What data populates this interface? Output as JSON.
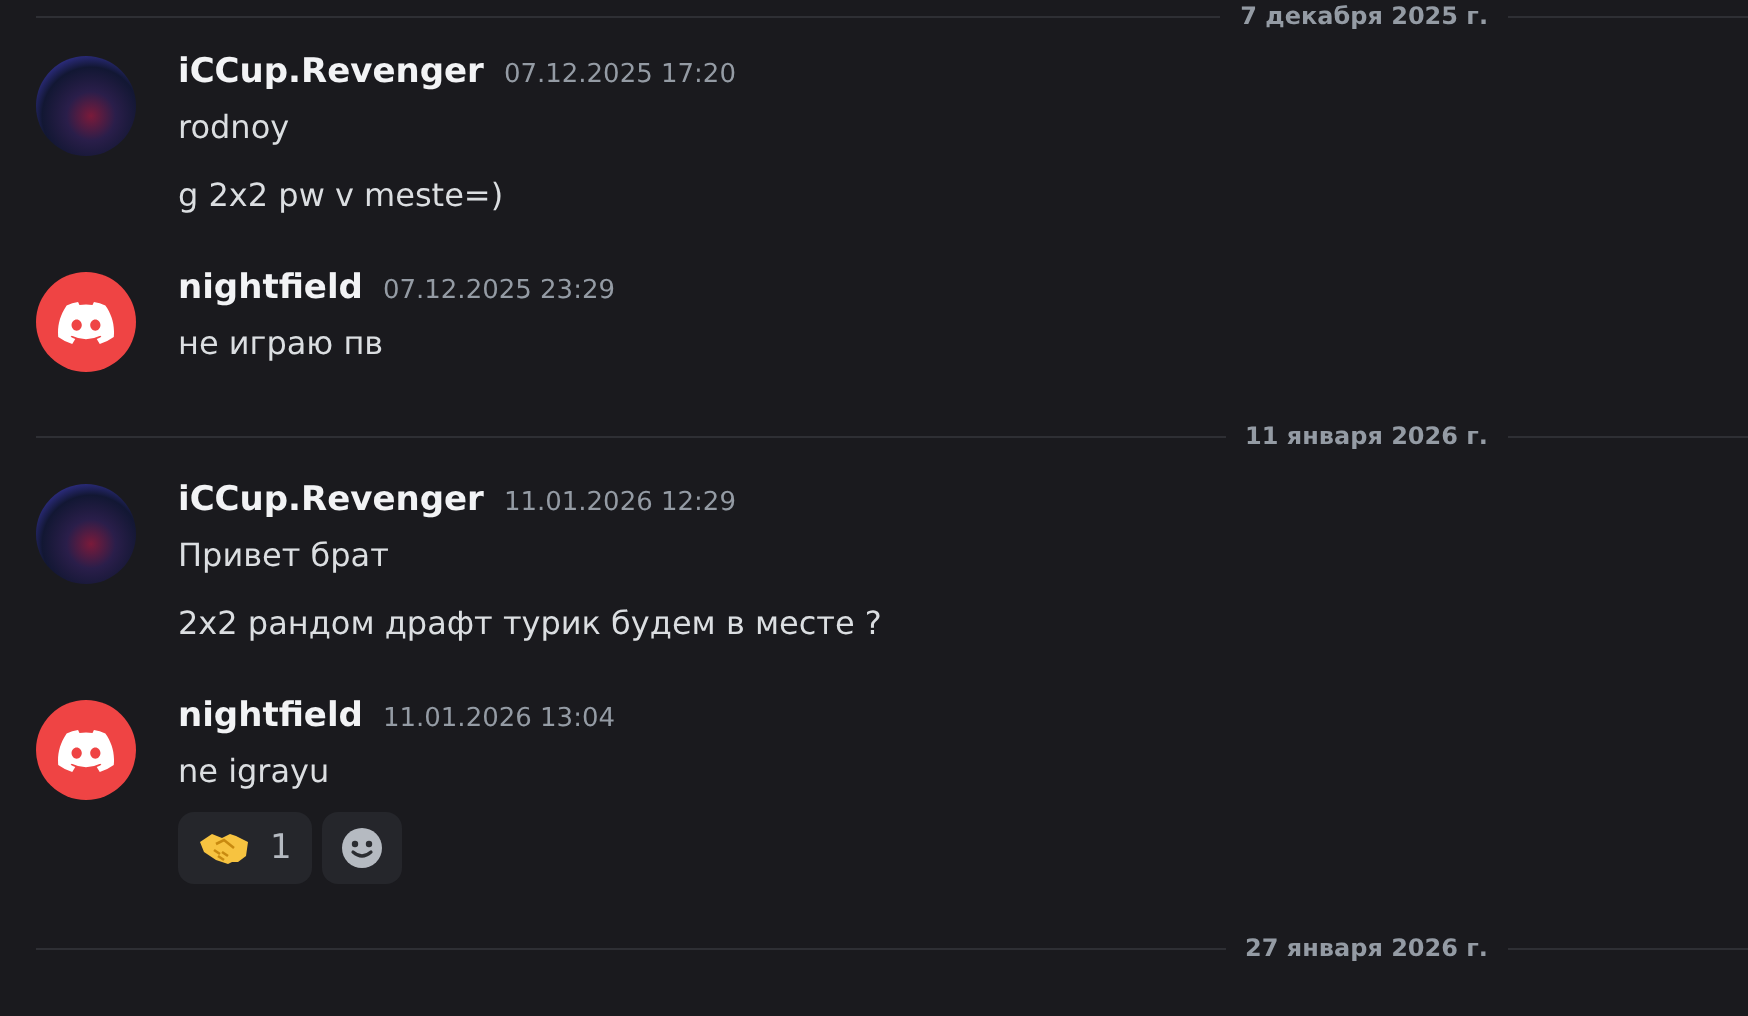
{
  "chat": [
    {
      "kind": "divider",
      "date": "7 декабря 2025 г."
    },
    {
      "kind": "message",
      "author": "iCCup.Revenger",
      "avatar": {
        "kind": "photo"
      },
      "timestamp": "07.12.2025 17:20",
      "lines": [
        "rodnoy",
        "g 2x2 pw v meste=)"
      ]
    },
    {
      "kind": "message",
      "author": "nightfield",
      "avatar": {
        "kind": "logo"
      },
      "timestamp": "07.12.2025 23:29",
      "lines": [
        "не играю пв"
      ]
    },
    {
      "kind": "divider",
      "date": "11 января 2026 г."
    },
    {
      "kind": "message",
      "author": "iCCup.Revenger",
      "avatar": {
        "kind": "photo"
      },
      "timestamp": "11.01.2026 12:29",
      "lines": [
        "Привет брат",
        "2x2 рандом драфт турик будем в месте ?"
      ]
    },
    {
      "kind": "message",
      "author": "nightfield",
      "avatar": {
        "kind": "logo"
      },
      "timestamp": "11.01.2026 13:04",
      "lines": [
        "ne igrayu"
      ],
      "reactions": [
        {
          "count": "1"
        }
      ]
    },
    {
      "kind": "divider",
      "date": "27 января 2026 г."
    }
  ]
}
